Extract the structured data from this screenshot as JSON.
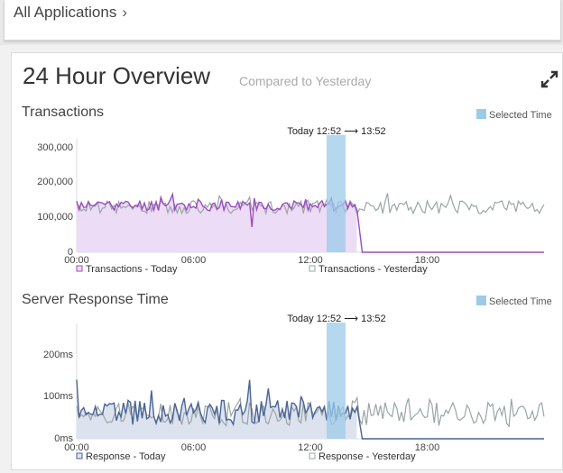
{
  "breadcrumb": {
    "label": "All Applications",
    "chevron": "›"
  },
  "overview": {
    "title": "24 Hour Overview",
    "subtitle": "Compared to Yesterday",
    "expand_icon": "expand-arrows-icon"
  },
  "colors": {
    "today_tx": "#9b4dbf",
    "today_tx_fill": "#ecdcf5",
    "yesterday": "#9aa5a5",
    "today_resp": "#4a6495",
    "today_resp_fill": "#dde2ef",
    "selected": "#9ccbe9"
  },
  "chart_data": [
    {
      "type": "line",
      "title": "Transactions",
      "selected_label": "Selected Time",
      "range_label": {
        "start": "Today 12:52",
        "arrow": "⟶",
        "end": "13:52"
      },
      "x_ticks": [
        "00:00",
        "06:00",
        "12:00",
        "18:00"
      ],
      "y_ticks": [
        "300,000",
        "200,000",
        "100,000",
        "0"
      ],
      "ylim": [
        0,
        300000
      ],
      "series": [
        {
          "name": "Transactions - Today",
          "approx_level": 130000,
          "variation": 15000,
          "ends_at": "13:52"
        },
        {
          "name": "Transactions - Yesterday",
          "approx_level": 125000,
          "variation": 18000
        }
      ]
    },
    {
      "type": "line",
      "title": "Server Response Time",
      "selected_label": "Selected Time",
      "range_label": {
        "start": "Today 12:52",
        "arrow": "⟶",
        "end": "13:52"
      },
      "x_ticks": [
        "00:00",
        "06:00",
        "12:00",
        "18:00"
      ],
      "y_ticks": [
        "200ms",
        "100ms",
        "0ms"
      ],
      "ylim": [
        0,
        270
      ],
      "series": [
        {
          "name": "Response - Today",
          "approx_level": 65,
          "variation": 30,
          "ends_at": "13:52"
        },
        {
          "name": "Response - Yesterday",
          "approx_level": 60,
          "variation": 30
        }
      ]
    }
  ]
}
